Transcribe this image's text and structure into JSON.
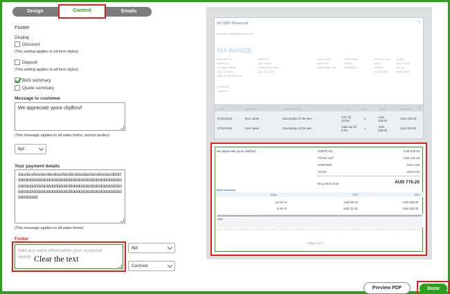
{
  "tabs": [
    {
      "label": "Design"
    },
    {
      "label": "Content"
    },
    {
      "label": "Emails"
    }
  ],
  "footer_panel": {
    "title": "Footer",
    "display_label": "Display",
    "options": [
      {
        "label": "Discount",
        "checked": false
      },
      {
        "label": "Deposit",
        "checked": false
      },
      {
        "label": "BAS summary",
        "checked": true
      },
      {
        "label": "Quote summary",
        "checked": false
      }
    ],
    "all_styles_note": "(This setting applies to all form styles)",
    "message_label": "Message to customer",
    "message_value": "We appreciate ypour ckjdhnvf",
    "message_note": "(This message applies to all sales forms, except quotes)",
    "message_font_size": "8pt",
    "payment_label": "Your payment details",
    "payment_value": "dasdasdasdasdasdasdasdasdasdasdasdasdasdddddddddddddddddddddddddddddddddddddddddddddddddddddddddddddddddddddddddddddddddddddddddddddddddddddddddddddddddddddddddddddddddddddddddd",
    "payment_note": "(This message applies to all sales forms)",
    "footer_label": "Footer",
    "footer_placeholder": "Add any extra information your customer needs",
    "footer_annotation": "Clear the text",
    "footer_font_size": "8pt",
    "footer_align": "Centred"
  },
  "preview": {
    "company": "AU QBO-Advanced",
    "email": "example_email@domain.com",
    "doc_title": "TAX INVOICE",
    "invoice_to_label": "INVOICE TO",
    "invoice_to": [
      "Smith Co.",
      "123 Main Street",
      "City, SA 1234",
      "ABN 12 345 678 901"
    ],
    "ship_to_label": "SHIP TO",
    "ship_to": [
      "John Smith",
      "23052 Park Drive",
      "City, SA 1234"
    ],
    "meta_left_labels": [
      "SHIP DATE",
      "SHIP VIA",
      "TRACKING NO."
    ],
    "meta_left_values": [
      "28/07/2016",
      "FedEx",
      "12345678"
    ],
    "meta_right_labels": [
      "INVOICE NO.",
      "DATE",
      "TERMS",
      "DUE DATE"
    ],
    "meta_right_values": [
      "12345",
      "01/07/2016",
      "Net 30",
      "06/02/2016"
    ],
    "custom_label": "CUSTOM",
    "custom_value": "Custom 1",
    "table_headers": [
      "DATE",
      "ACTIVITY",
      "DESCRIPTION",
      "GST",
      "QTY",
      "RATE",
      "AMOUNT"
    ],
    "rows": [
      {
        "date": "07/01/2016",
        "activity": "Item name",
        "desc": "Description of the item",
        "gst": "GST @ 10.0%",
        "qty": "2",
        "rate": "AUD 225.00",
        "amount": "AUD 450.00"
      },
      {
        "date": "07/01/2016",
        "activity": "Item name",
        "desc": "Description of the item",
        "gst": "Input tax @ 0.0%",
        "qty": "1",
        "rate": "AUD 225.00",
        "amount": "AUD 225.00"
      }
    ],
    "footer_message": "We appreciate ypour ckjdhnvf",
    "totals": [
      {
        "label": "SUBTOTAL",
        "value": "AUD 675.00"
      },
      {
        "label": "TOTAL GST",
        "value": "AUD 101.25"
      },
      {
        "label": "SHIPPING",
        "value": "AUD 3.50"
      },
      {
        "label": "TOTAL",
        "value": "AUD 0.00"
      }
    ],
    "balance_label": "BALANCE DUE",
    "balance_value": "AUD 776.25",
    "bas_label": "BAS summary",
    "bas_headers": [
      "Rate",
      "GST",
      "Net"
    ],
    "bas_rows": [
      {
        "rate": "20.0% S",
        "gst": "AUD 90.00",
        "net": "AUD 450.00"
      },
      {
        "rate": "5.0% R",
        "gst": "AUD 11.25",
        "net": "AUD 225.00"
      }
    ],
    "payment_preview": "dasdasdasdasdasdasdasdasdasdasdasdddddddddddddddddddddddddddddddddddddddddddddddddddddddddddddddddddddddddddddddddddddddddddddddddddddddddddddddddddddddd",
    "page_label": "Page 1 of 1"
  },
  "actions": {
    "preview_pdf": "Preview PDF",
    "done": "Done"
  },
  "colors": {
    "brand_green": "#2ca01c",
    "highlight_red": "#e51a1a",
    "tab_gray": "#7c7c7c"
  }
}
